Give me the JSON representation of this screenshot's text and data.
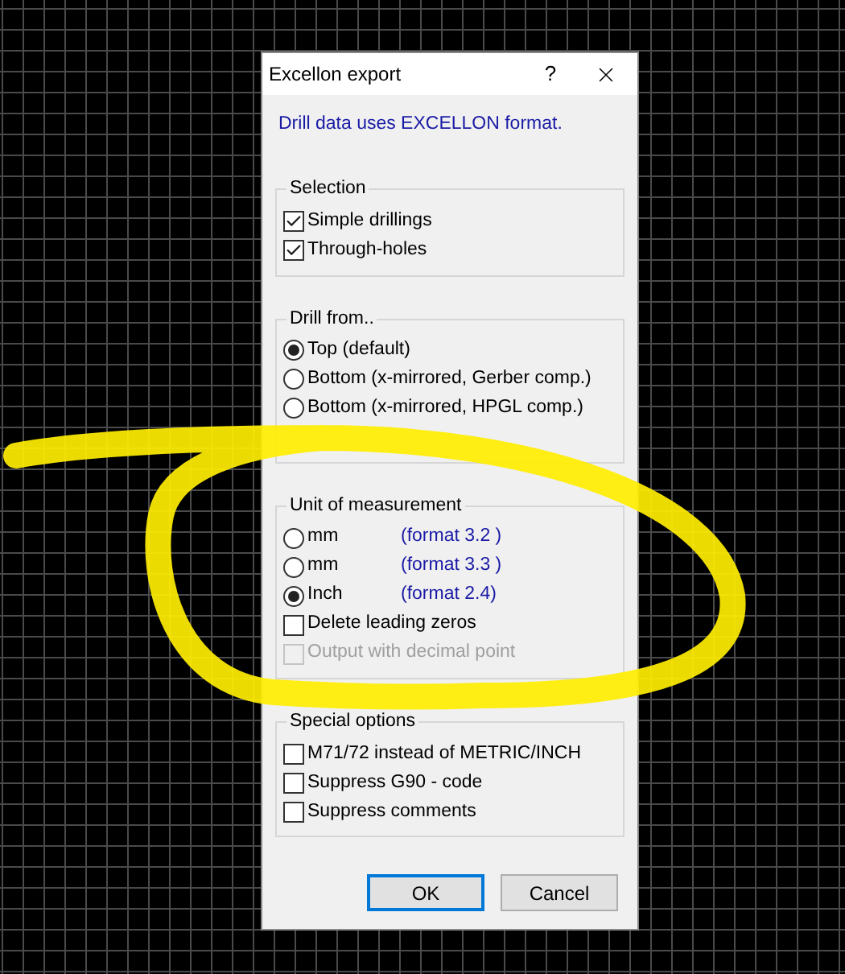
{
  "window": {
    "title": "Excellon export",
    "help_button": "?"
  },
  "info": "Drill data uses EXCELLON format.",
  "groups": [
    {
      "title": "Selection",
      "items": [
        {
          "kind": "checkbox",
          "label": "Simple drillings",
          "checked": true,
          "disabled": false
        },
        {
          "kind": "checkbox",
          "label": "Through-holes",
          "checked": true,
          "disabled": false
        }
      ]
    },
    {
      "title": "Drill from..",
      "items": [
        {
          "kind": "radio",
          "label": "Top (default)",
          "selected": true
        },
        {
          "kind": "radio",
          "label": "Bottom (x-mirrored, Gerber comp.)",
          "selected": false
        },
        {
          "kind": "radio",
          "label": "Bottom (x-mirrored, HPGL comp.)",
          "selected": false
        }
      ]
    },
    {
      "title": "Unit of measurement",
      "items": [
        {
          "kind": "radio",
          "label": "mm",
          "note": "(format 3.2 )",
          "selected": false
        },
        {
          "kind": "radio",
          "label": "mm",
          "note": "(format 3.3 )",
          "selected": false
        },
        {
          "kind": "radio",
          "label": "Inch",
          "note": "(format 2.4)",
          "selected": true
        },
        {
          "kind": "checkbox",
          "label": "Delete leading zeros",
          "checked": false,
          "disabled": false
        },
        {
          "kind": "checkbox",
          "label": "Output with decimal point",
          "checked": false,
          "disabled": true
        }
      ]
    },
    {
      "title": "Special options",
      "items": [
        {
          "kind": "checkbox",
          "label": "M71/72 instead of METRIC/INCH",
          "checked": false,
          "disabled": false
        },
        {
          "kind": "checkbox",
          "label": "Suppress G90 - code",
          "checked": false,
          "disabled": false
        },
        {
          "kind": "checkbox",
          "label": "Suppress comments",
          "checked": false,
          "disabled": false
        }
      ]
    }
  ],
  "buttons": [
    {
      "label": "OK",
      "default": true
    },
    {
      "label": "Cancel",
      "default": false
    }
  ]
}
